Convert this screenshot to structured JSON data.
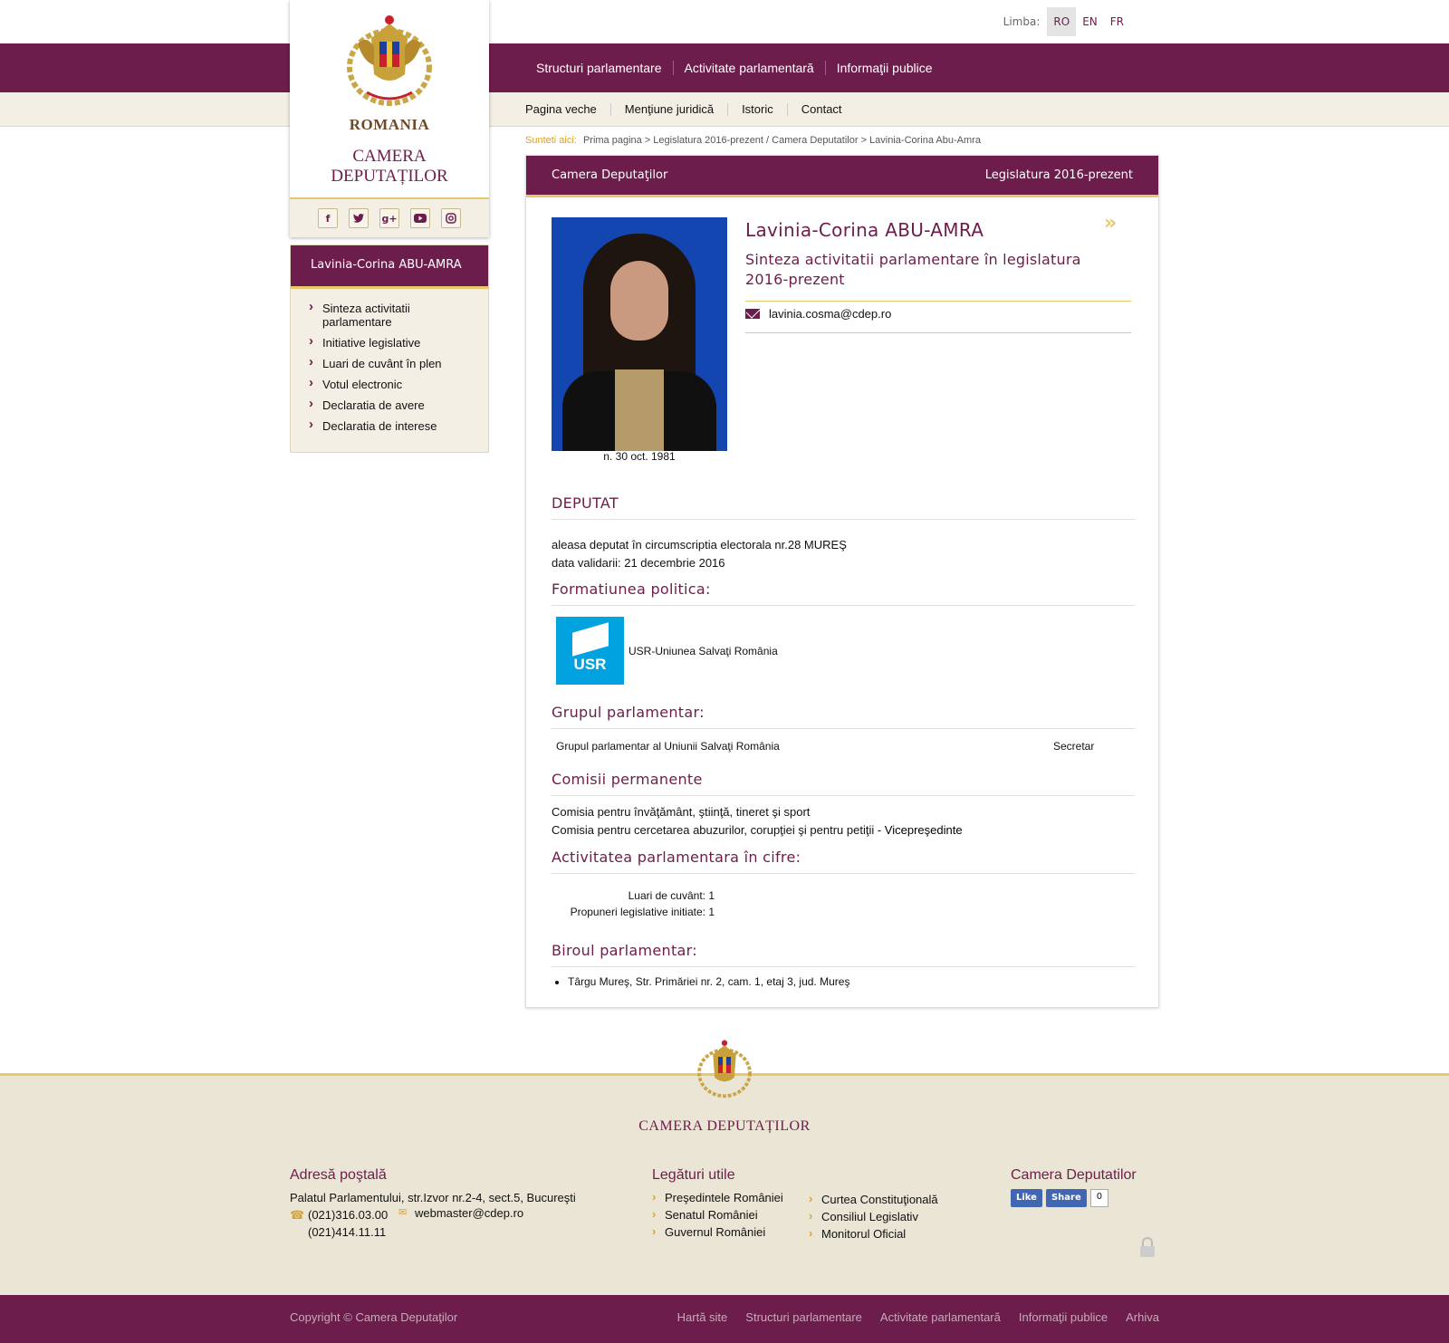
{
  "lang": {
    "label": "Limba:",
    "options": [
      "RO",
      "EN",
      "FR"
    ],
    "selected": "RO"
  },
  "logo": {
    "country": "ROMANIA",
    "institution_line1": "CAMERA",
    "institution_line2": "DEPUTAȚILOR"
  },
  "social": [
    "facebook-icon",
    "twitter-icon",
    "google-plus-icon",
    "youtube-icon",
    "instagram-icon"
  ],
  "main_nav": [
    "Structuri parlamentare",
    "Activitate parlamentară",
    "Informaţii publice"
  ],
  "sub_nav": [
    "Pagina veche",
    "Menţiune juridică",
    "Istoric",
    "Contact"
  ],
  "breadcrumb": {
    "prefix": "Sunteti aici:",
    "path": "Prima pagina > Legislatura 2016-prezent / Camera Deputatilor > Lavinia-Corina Abu-Amra"
  },
  "left_menu": {
    "title": "Lavinia-Corina ABU-AMRA",
    "items": [
      "Sinteza activitatii parlamentare",
      "Initiative legislative",
      "Luari de cuvânt în plen",
      "Votul electronic",
      "Declaratia de avere",
      "Declaratia de interese"
    ]
  },
  "panel": {
    "left_title": "Camera Deputaţilor",
    "right_title": "Legislatura 2016-prezent"
  },
  "profile": {
    "name": "Lavinia-Corina ABU-AMRA",
    "subtitle": "Sinteza activitatii parlamentare în legislatura 2016-prezent",
    "email": "lavinia.cosma@cdep.ro",
    "dob": "n. 30 oct. 1981"
  },
  "deputat": {
    "heading": "DEPUTAT",
    "line1": "aleasa deputat în circumscriptia electorala nr.28 MUREŞ",
    "line2": "data validarii: 21 decembrie 2016"
  },
  "formatiune": {
    "heading": "Formatiunea politica:",
    "logo_text": "USR",
    "name": "USR-Uniunea Salvaţi România"
  },
  "grup": {
    "heading": "Grupul parlamentar:",
    "name": "Grupul parlamentar al Uniunii Salvaţi România",
    "role": "Secretar"
  },
  "comisii": {
    "heading": "Comisii permanente",
    "items": [
      "Comisia pentru învăţământ, ştiinţă, tineret şi sport",
      "Comisia pentru cercetarea abuzurilor, corupţiei şi pentru petiţii"
    ],
    "role": "Vicepreşedinte",
    "role_sep": " - "
  },
  "cifre": {
    "heading": "Activitatea parlamentara în cifre:",
    "luari": "Luari de cuvânt: 1",
    "propuneri": "Propuneri legislative initiate: 1"
  },
  "birou": {
    "heading": "Biroul parlamentar:",
    "address": "Târgu Mureş, Str. Primăriei nr. 2, cam. 1, etaj 3, jud. Mureş"
  },
  "footer": {
    "brand": "CAMERA DEPUTAȚILOR",
    "address_heading": "Adresă poştală",
    "address": "Palatul Parlamentului, str.Izvor nr.2-4, sect.5, Bucureşti",
    "phone1": "(021)316.03.00",
    "phone2": "(021)414.11.11",
    "email": "webmaster@cdep.ro",
    "links_heading": "Legături utile",
    "links_col1": [
      "Preşedintele României",
      "Senatul României",
      "Guvernul României"
    ],
    "links_col2": [
      "Curtea Constituţională",
      "Consiliul Legislativ",
      "Monitorul Oficial"
    ],
    "social_heading": "Camera Deputatilor",
    "like": "Like",
    "share": "Share",
    "share_count": "0",
    "copyright": "Copyright © Camera Deputaţilor",
    "bottom_links": [
      "Hartă site",
      "Structuri parlamentare",
      "Activitate parlamentară",
      "Informaţii publice",
      "Arhiva"
    ]
  },
  "colors": {
    "brand": "#6d1d4b",
    "accent": "#e8c86b",
    "beige": "#f4efe5",
    "usr_blue": "#00a3e0"
  }
}
